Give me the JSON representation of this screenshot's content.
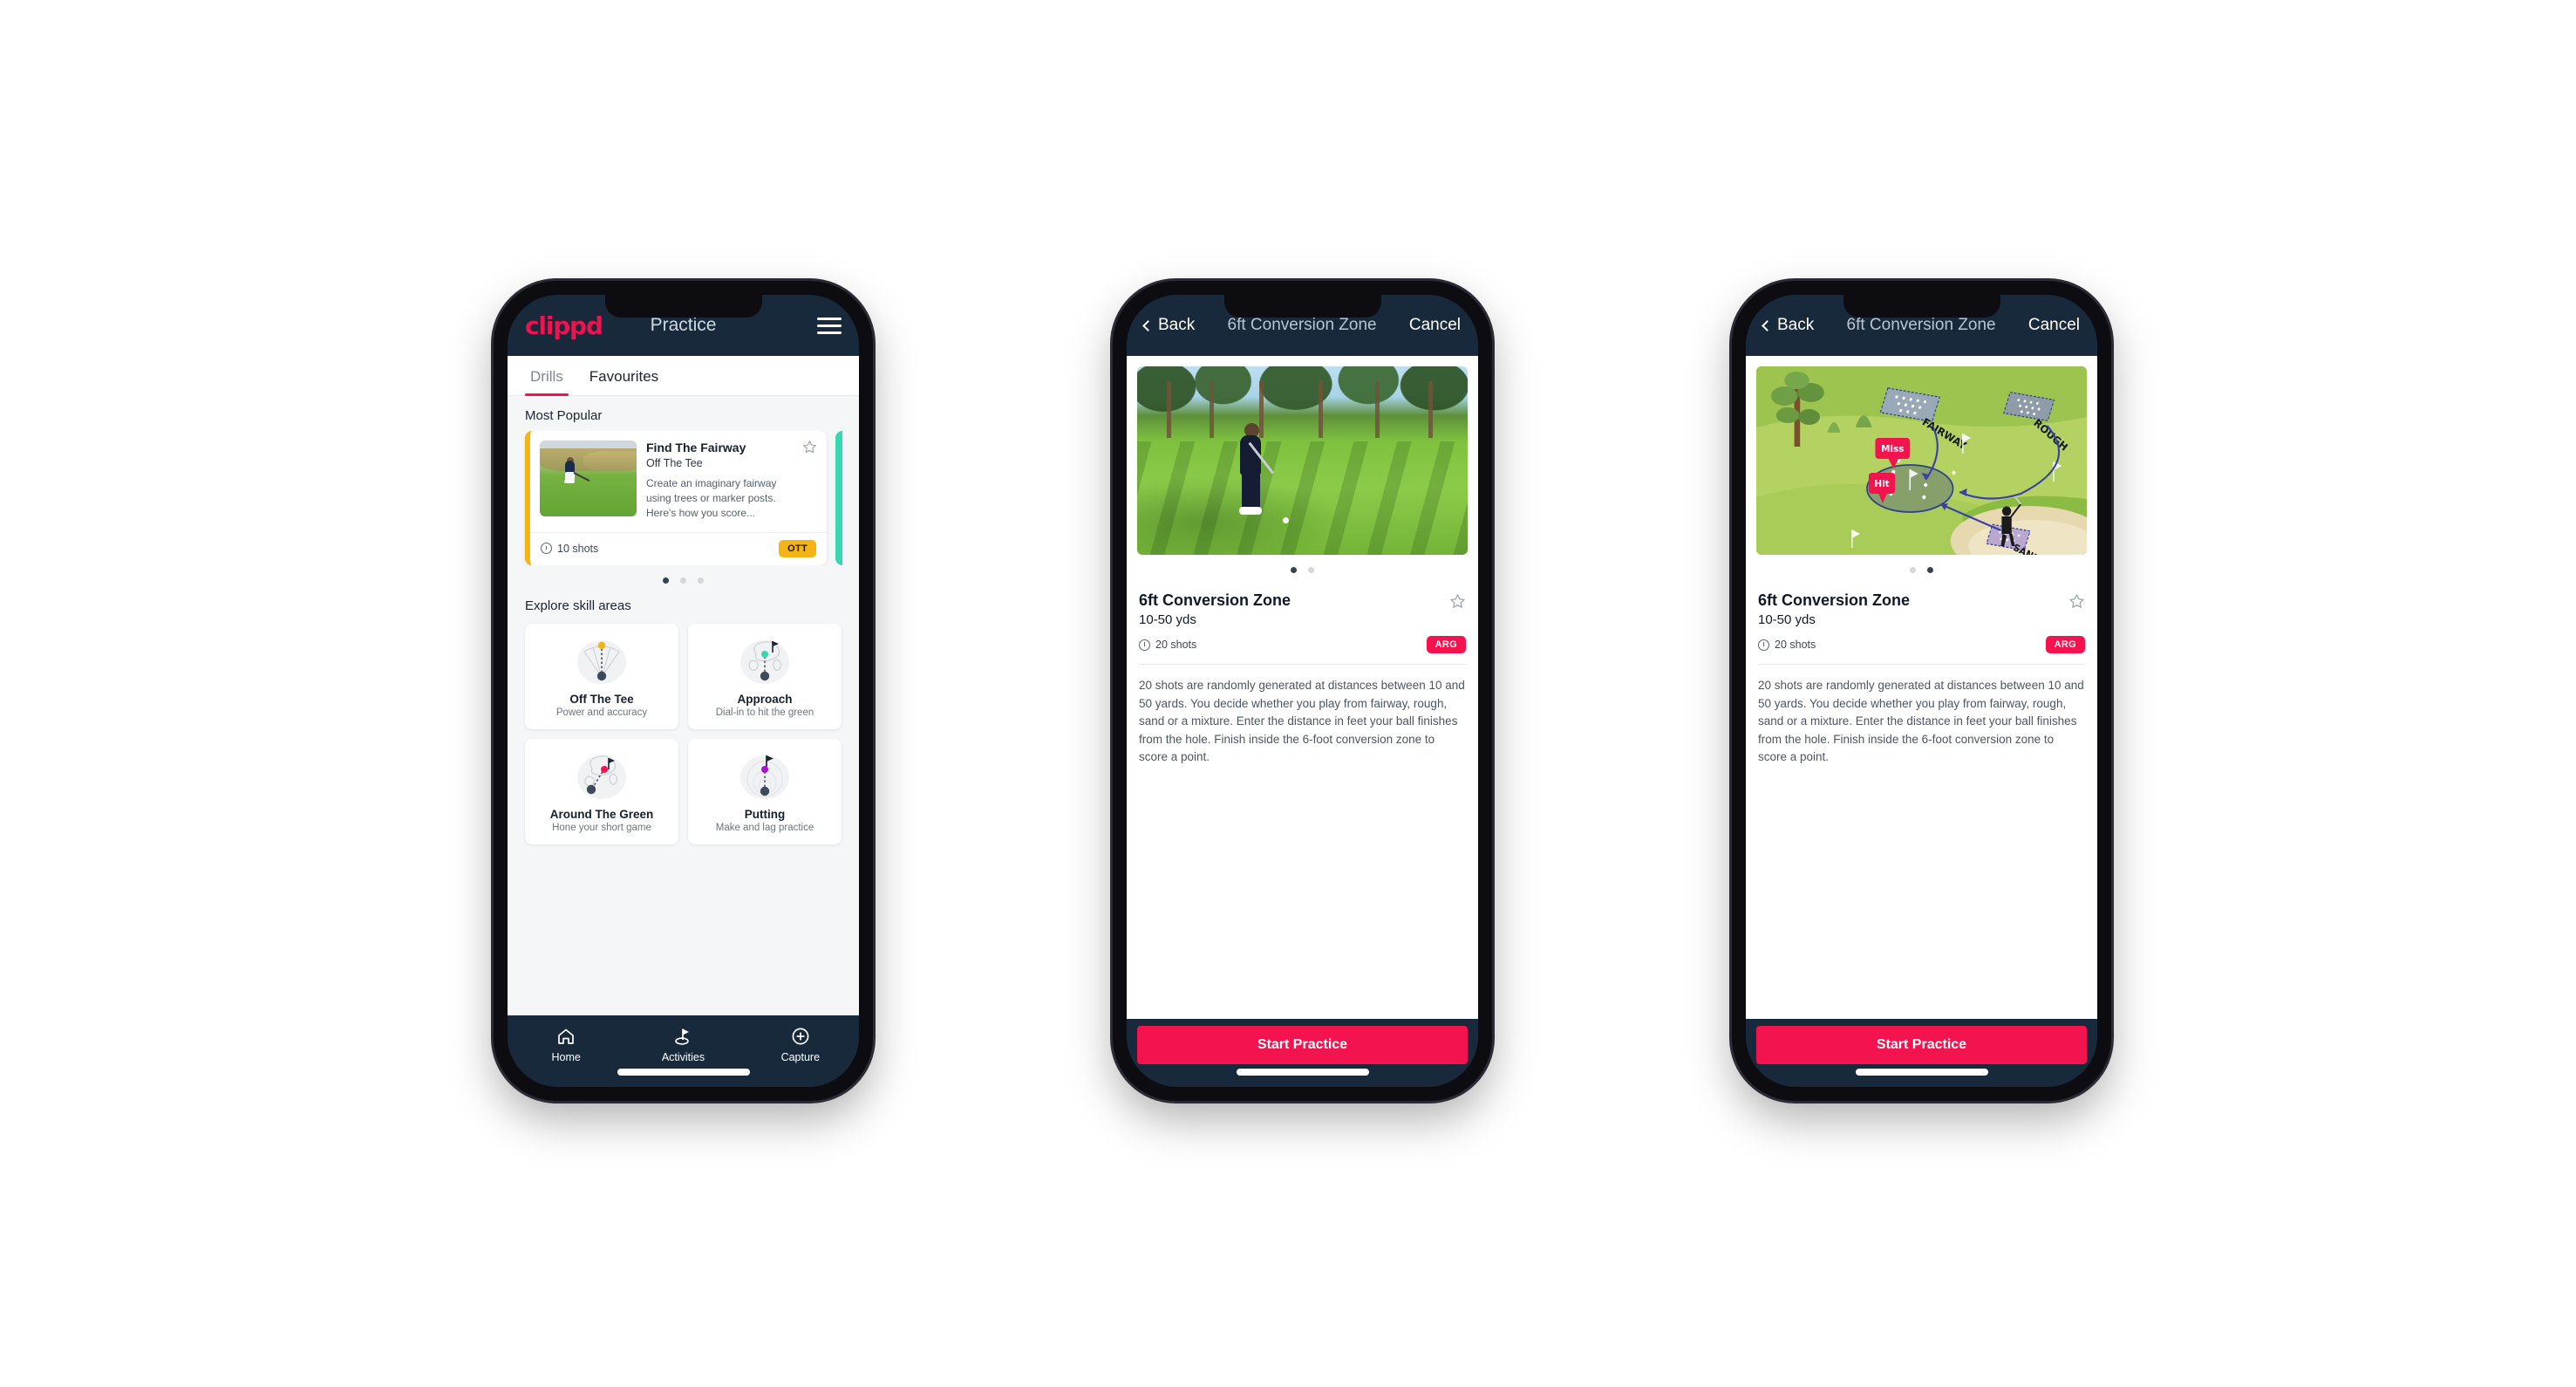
{
  "colors": {
    "brand_pink": "#ed1250",
    "header_navy": "#17293a",
    "badge_ott": "#f5b416",
    "badge_arg": "#f2134f",
    "teal_accent": "#35d8b0",
    "page_bg": "#f5f6f8"
  },
  "phone1": {
    "header": {
      "brand": "clippd",
      "title": "Practice",
      "menu_icon": "hamburger-icon"
    },
    "tabs": [
      {
        "label": "Drills",
        "active": true
      },
      {
        "label": "Favourites",
        "active": false
      }
    ],
    "most_popular": {
      "section_title": "Most Popular",
      "card": {
        "name": "Find The Fairway",
        "category": "Off The Tee",
        "description": "Create an imaginary fairway using trees or marker posts. Here's how you score...",
        "shots": "10 shots",
        "badge": "OTT",
        "favourite_icon": "star-outline-icon",
        "shots_icon": "clock-icon"
      },
      "dots": [
        true,
        false,
        false
      ]
    },
    "skills": {
      "section_title": "Explore skill areas",
      "items": [
        {
          "name": "Off The Tee",
          "sub": "Power and accuracy",
          "icon": "off-the-tee-icon"
        },
        {
          "name": "Approach",
          "sub": "Dial-in to hit the green",
          "icon": "approach-icon"
        },
        {
          "name": "Around The Green",
          "sub": "Hone your short game",
          "icon": "around-the-green-icon"
        },
        {
          "name": "Putting",
          "sub": "Make and lag practice",
          "icon": "putting-icon"
        }
      ]
    },
    "bottom_nav": [
      {
        "label": "Home",
        "icon": "home-icon",
        "active": false
      },
      {
        "label": "Activities",
        "icon": "golf-flag-icon",
        "active": true
      },
      {
        "label": "Capture",
        "icon": "plus-circle-icon",
        "active": false
      }
    ]
  },
  "phone2": {
    "nav": {
      "back": "Back",
      "title": "6ft Conversion Zone",
      "cancel": "Cancel",
      "back_icon": "chevron-left-icon"
    },
    "media": {
      "type": "photo",
      "alt": "golfer chipping on green with pine trees"
    },
    "dots": [
      true,
      false
    ],
    "detail": {
      "title": "6ft Conversion Zone",
      "subtitle": "10-50 yds",
      "shots": "20 shots",
      "badge": "ARG",
      "favourite_icon": "star-outline-icon",
      "shots_icon": "clock-icon",
      "description": "20 shots are randomly generated at distances between 10 and 50 yards. You decide whether you play from fairway, rough, sand or a mixture. Enter the distance in feet your ball finishes from the hole. Finish inside the 6-foot conversion zone to score a point."
    },
    "cta": "Start Practice"
  },
  "phone3": {
    "nav": {
      "back": "Back",
      "title": "6ft Conversion Zone",
      "cancel": "Cancel",
      "back_icon": "chevron-left-icon"
    },
    "media": {
      "type": "illustration",
      "labels": {
        "fairway": "FAIRWAY",
        "rough": "ROUGH",
        "sand": "SAND",
        "miss": "Miss",
        "hit": "Hit"
      }
    },
    "dots": [
      false,
      true
    ],
    "detail": {
      "title": "6ft Conversion Zone",
      "subtitle": "10-50 yds",
      "shots": "20 shots",
      "badge": "ARG",
      "favourite_icon": "star-outline-icon",
      "shots_icon": "clock-icon",
      "description": "20 shots are randomly generated at distances between 10 and 50 yards. You decide whether you play from fairway, rough, sand or a mixture. Enter the distance in feet your ball finishes from the hole. Finish inside the 6-foot conversion zone to score a point."
    },
    "cta": "Start Practice"
  }
}
